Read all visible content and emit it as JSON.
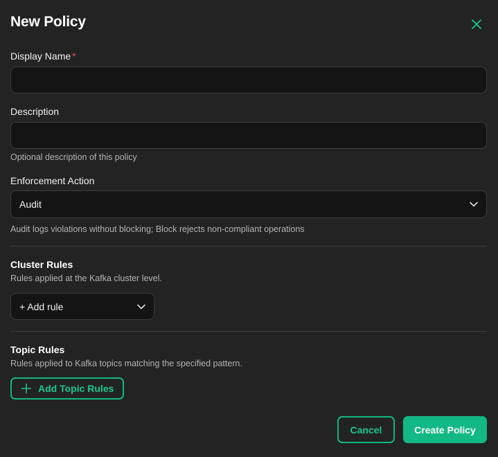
{
  "dialog": {
    "title": "New Policy",
    "close_icon": "close-icon",
    "accent_color": "#12b885"
  },
  "form": {
    "display_name": {
      "label": "Display Name",
      "required_marker": "*",
      "value": ""
    },
    "description": {
      "label": "Description",
      "value": "",
      "help": "Optional description of this policy"
    },
    "enforcement": {
      "label": "Enforcement Action",
      "selected": "Audit",
      "help": "Audit logs violations without blocking; Block rejects non-compliant operations"
    }
  },
  "cluster_rules": {
    "title": "Cluster Rules",
    "subtitle": "Rules applied at the Kafka cluster level.",
    "add_rule_label": "+ Add rule"
  },
  "topic_rules": {
    "title": "Topic Rules",
    "subtitle": "Rules applied to Kafka topics matching the specified pattern.",
    "add_button_label": "Add Topic Rules",
    "add_icon": "plus-icon"
  },
  "footer": {
    "cancel_label": "Cancel",
    "create_label": "Create Policy"
  }
}
